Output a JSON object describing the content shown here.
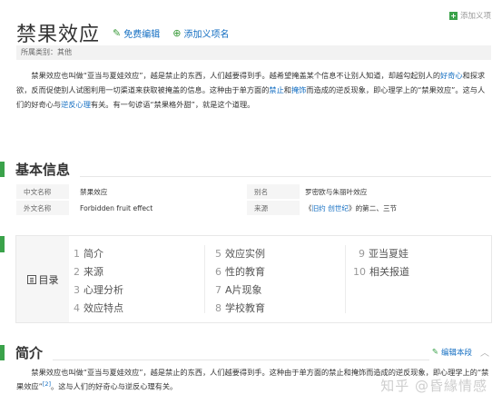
{
  "header": {
    "title": "禁果效应",
    "edit_label": "免费编辑",
    "add_sense_label": "添加义项名",
    "add_entry_label": "添加义项"
  },
  "category": {
    "text": "所属类别：其他"
  },
  "intro": {
    "p1": "禁果效应也叫做“亚当与夏娃效应”，越是禁止的东西，人们越要得到手。越希望掩盖某个信息不让别人知道，却越勾起别人的",
    "link_curiosity": "好奇心",
    "p2": "和探求欲，反而促使别人试图利用一切渠道来获取被掩盖的信息。这种由于单方面的",
    "link_ban": "禁止",
    "p3": "和",
    "link_cover": "掩饰",
    "p4": "而造成的逆反现象，即心理学上的“禁果效应”。这与人们的好奇心与",
    "link_reverse": "逆反心理",
    "p5": "有关。有一句谚语“禁果格外甜”，就是这个道理。"
  },
  "basic_info": {
    "title": "基本信息",
    "rows": [
      {
        "k1": "中文名称",
        "v1": "禁果效应",
        "k2": "别名",
        "v2": "罗密欧与朱丽叶效应"
      },
      {
        "k1": "外文名称",
        "v1": "Forbidden fruit effect",
        "k2": "来源",
        "v2_pre": "《",
        "v2_link": "旧约 创世纪",
        "v2_post": "》的第二、三节"
      }
    ]
  },
  "toc": {
    "label": "目录",
    "items": [
      {
        "num": "1",
        "text": "简介"
      },
      {
        "num": "2",
        "text": "来源"
      },
      {
        "num": "3",
        "text": "心理分析"
      },
      {
        "num": "4",
        "text": "效应特点"
      },
      {
        "num": "5",
        "text": "效应实例"
      },
      {
        "num": "6",
        "text": "性的教育"
      },
      {
        "num": "7",
        "text": "A片现象"
      },
      {
        "num": "8",
        "text": "学校教育"
      },
      {
        "num": "9",
        "text": "亚当夏娃"
      },
      {
        "num": "10",
        "text": "相关报道"
      }
    ]
  },
  "summary_section": {
    "title": "简介",
    "edit_label": "编辑本段",
    "p1": "禁果效应也叫做“亚当与夏娃效应”，越是禁止的东西，人们越要得到手。这种由于单方面的禁止和掩饰而造成的逆反现象，即心理学上的“禁果效应”",
    "ref": "[2]",
    "p2": "。这与人们的好奇心与逆反心理有关。"
  },
  "watermark": "知乎 @昏緣情感",
  "colors": {
    "accent_green": "#3aa24a",
    "link_blue": "#136ec2"
  }
}
